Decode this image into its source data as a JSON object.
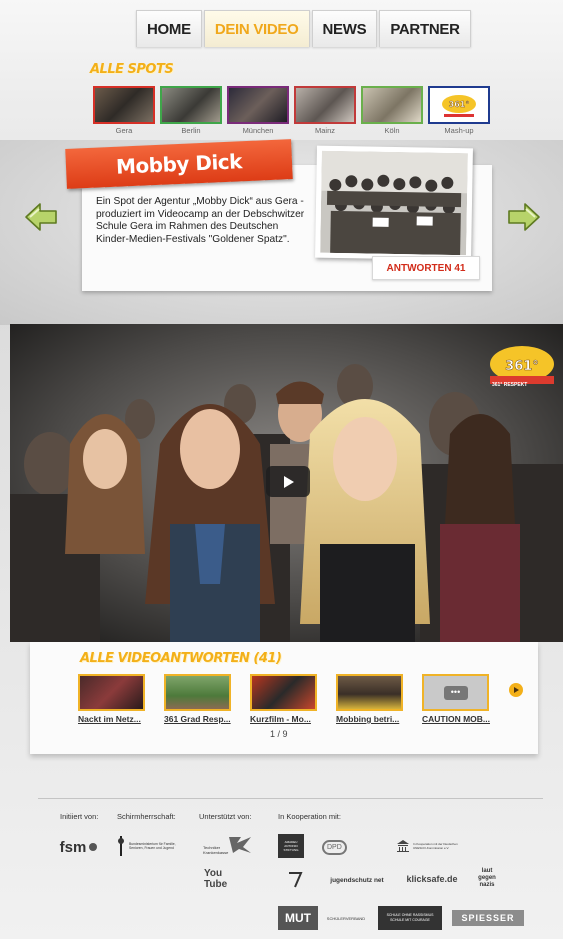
{
  "nav": {
    "tabs": [
      {
        "label": "HOME",
        "active": false
      },
      {
        "label": "DEIN VIDEO",
        "active": true
      },
      {
        "label": "NEWS",
        "active": false
      },
      {
        "label": "PARTNER",
        "active": false
      }
    ]
  },
  "spots": {
    "title": "ALLE SPOTS",
    "items": [
      {
        "label": "Gera",
        "border": "#d63027"
      },
      {
        "label": "Berlin",
        "border": "#3fa64a"
      },
      {
        "label": "München",
        "border": "#7a2b7a"
      },
      {
        "label": "Mainz",
        "border": "#c13a3a"
      },
      {
        "label": "Köln",
        "border": "#6ab04c"
      },
      {
        "label": "Mash-up",
        "border": "#1f3b8f"
      }
    ]
  },
  "feature": {
    "title": "Mobby Dick",
    "description": "Ein Spot der Agentur „Mobby Dick“ aus Gera - produziert im Videocamp an der Debschwitzer Schule Gera im Rahmen des Deutschen Kinder-Medien-Festivals \"Goldener Spatz\".",
    "answers_button": "ANTWORTEN 41"
  },
  "video": {
    "badge": "361° RESPEKT"
  },
  "answers": {
    "title": "ALLE VIDEOANTWORTEN (41)",
    "items": [
      {
        "title": "Nackt im Netz..."
      },
      {
        "title": "361 Grad Resp..."
      },
      {
        "title": "Kurzfilm - Mo..."
      },
      {
        "title": "Mobbing betri..."
      },
      {
        "title": "CAUTION MOB..."
      }
    ],
    "pager": "1 / 9"
  },
  "footer": {
    "headings": {
      "initiiert": "Initiiert von:",
      "schirmherrschaft": "Schirmherrschaft:",
      "unterstuetzt": "Unterstützt von:",
      "kooperation": "In Kooperation mit:"
    },
    "logos": {
      "fsm": "fsm",
      "bmfsfj": "Bundesministerium für Familie, Senioren, Frauen und Jugend",
      "tk": "Techniker Krankenkasse",
      "youtube": "You Tube",
      "amadeu": "AMADEU ANTONIO STIFTUNG",
      "dpd": "DPD",
      "unesco": "In Kooperation mit der Deutschen UNESCO-Kommission e.V.",
      "jugendschutz": "jugendschutz net",
      "klicksafe": "klicksafe.de",
      "laut": "laut gegen nazis",
      "mut": "MUT",
      "schuelerverband": "SCHÜLERVERBAND",
      "schule": "SCHULE OHNE RASSISMUS SCHULE MIT COURAGE",
      "spiesser": "SPIESSER"
    }
  }
}
